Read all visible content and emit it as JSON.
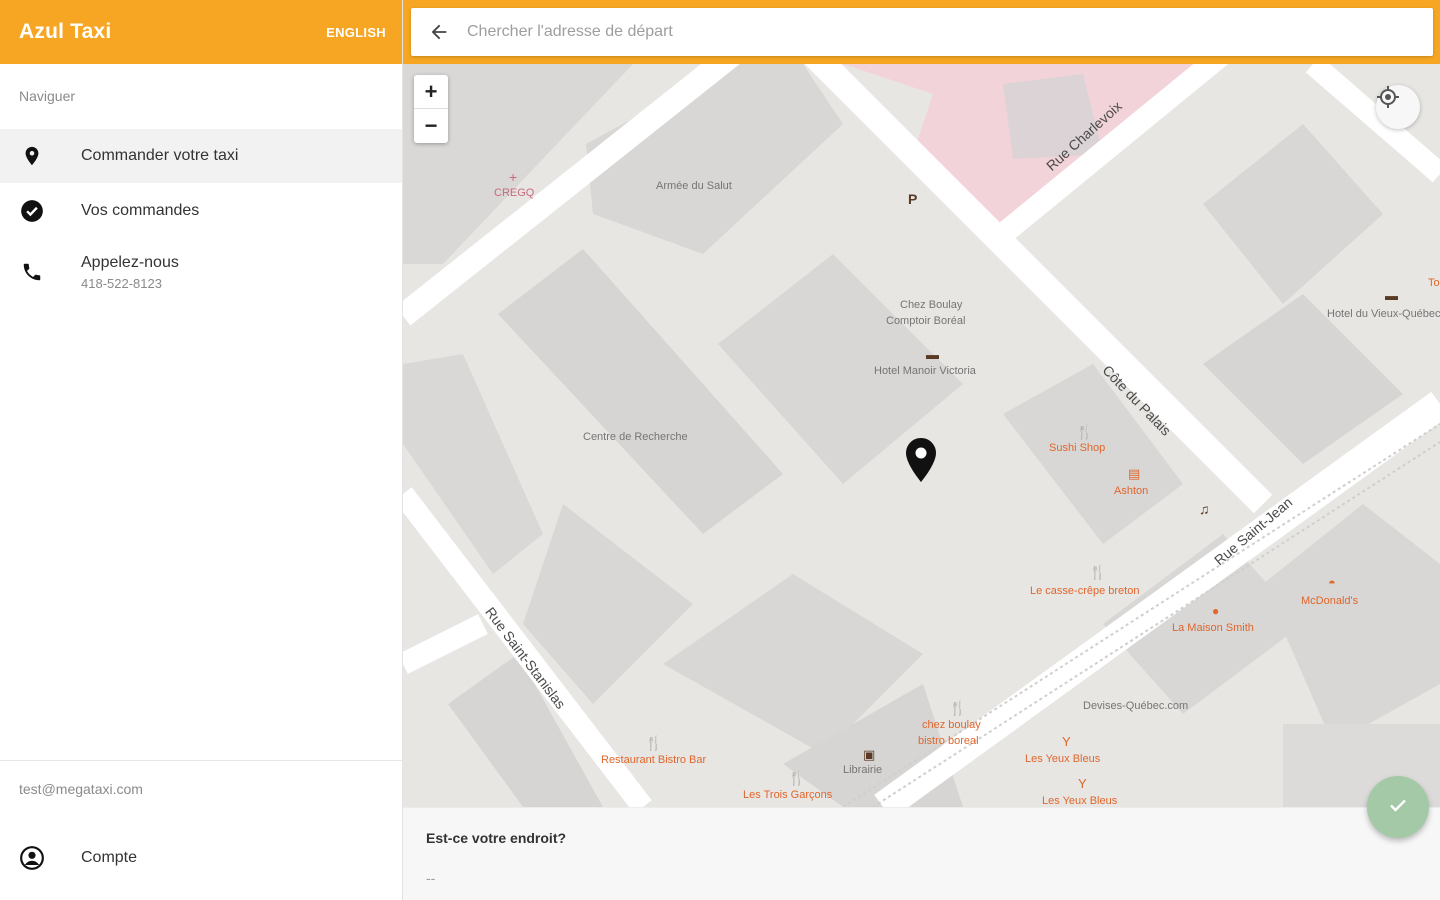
{
  "app": {
    "title": "Azul Taxi",
    "language_button": "ENGLISH",
    "accent_color": "#f6a623"
  },
  "drawer": {
    "section_label": "Naviguer",
    "items": [
      {
        "label": "Commander votre taxi",
        "icon": "location-pin-icon",
        "active": true
      },
      {
        "label": "Vos commandes",
        "icon": "check-circle-icon",
        "active": false
      },
      {
        "label": "Appelez-nous",
        "sublabel": "418-522-8123",
        "icon": "phone-icon",
        "active": false
      }
    ],
    "user_email": "test@megataxi.com",
    "account_label": "Compte"
  },
  "search": {
    "placeholder": "Chercher l'adresse de départ",
    "value": ""
  },
  "map": {
    "zoom_in": "+",
    "zoom_out": "−",
    "streets": [
      "Rue Charlevoix",
      "Côte du Palais",
      "Rue Saint-Jean",
      "Rue Saint-Stanislas"
    ],
    "places": [
      {
        "name": "CREGQ",
        "kind": "pink"
      },
      {
        "name": "Armée du Salut",
        "kind": "gray"
      },
      {
        "name": "Chez Boulay",
        "kind": "gray"
      },
      {
        "name": "Comptoir Boréal",
        "kind": "gray"
      },
      {
        "name": "Hotel Manoir Victoria",
        "kind": "gray"
      },
      {
        "name": "Centre de Recherche",
        "kind": "gray"
      },
      {
        "name": "Sushi Shop",
        "kind": "poi"
      },
      {
        "name": "Ashton",
        "kind": "poi"
      },
      {
        "name": "Le casse-crêpe breton",
        "kind": "poi"
      },
      {
        "name": "McDonald's",
        "kind": "poi"
      },
      {
        "name": "La Maison Smith",
        "kind": "poi"
      },
      {
        "name": "Devises-Québec.com",
        "kind": "gray"
      },
      {
        "name": "chez boulay",
        "kind": "poi"
      },
      {
        "name": "bistro boreal",
        "kind": "poi"
      },
      {
        "name": "Les Yeux Bleus",
        "kind": "poi"
      },
      {
        "name": "Les Yeux Bleus",
        "kind": "poi"
      },
      {
        "name": "Librairie",
        "kind": "gray"
      },
      {
        "name": "Les Trois Garçons",
        "kind": "poi"
      },
      {
        "name": "Restaurant Bistro Bar",
        "kind": "poi"
      },
      {
        "name": "Hotel du Vieux-Québec",
        "kind": "gray"
      },
      {
        "name": "To",
        "kind": "poi"
      }
    ]
  },
  "bottom_sheet": {
    "question": "Est-ce votre endroit?",
    "address": "--"
  }
}
